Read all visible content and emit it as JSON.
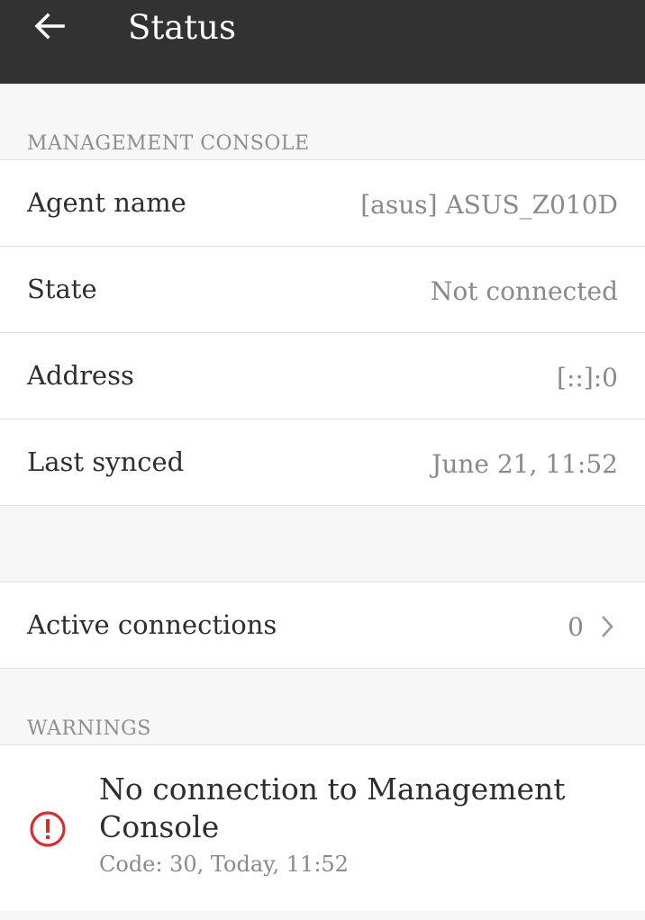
{
  "appbar": {
    "title": "Status",
    "back_icon": "arrow-left-icon"
  },
  "management_console": {
    "header": "MANAGEMENT CONSOLE",
    "rows": [
      {
        "label": "Agent name",
        "value": "[asus] ASUS_Z010D"
      },
      {
        "label": "State",
        "value": "Not connected"
      },
      {
        "label": "Address",
        "value": "[::]:0"
      },
      {
        "label": "Last synced",
        "value": "June 21, 11:52"
      }
    ]
  },
  "active_connections": {
    "label": "Active connections",
    "value": "0",
    "chevron_icon": "chevron-right-icon"
  },
  "warnings": {
    "header": "WARNINGS",
    "items": [
      {
        "icon": "error-circle-icon",
        "title": "No connection to Management Console",
        "subtitle": "Code: 30, Today, 11:52"
      }
    ]
  },
  "colors": {
    "appbar_bg": "#323232",
    "page_bg": "#f7f7f7",
    "error_red": "#d32f2f"
  }
}
